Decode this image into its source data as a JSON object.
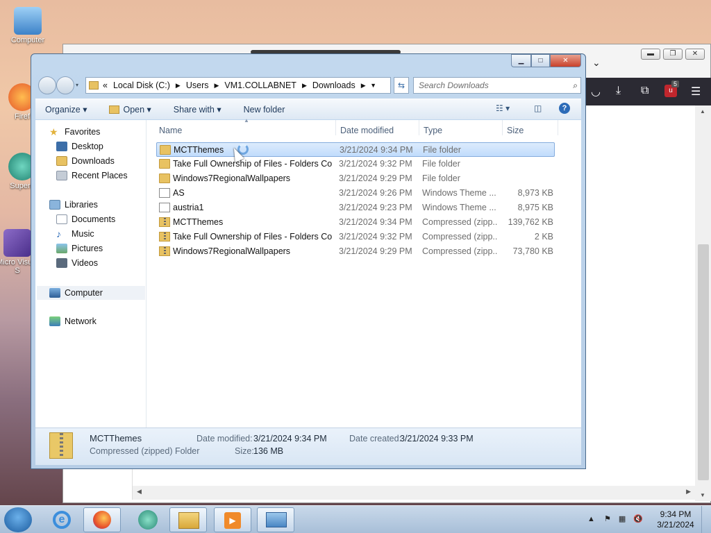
{
  "desktop": {
    "icons": [
      {
        "label": "Computer"
      },
      {
        "label": "Firef"
      },
      {
        "label": "Supern"
      },
      {
        "label": "Micro Visual S"
      }
    ]
  },
  "explorer": {
    "address": {
      "overflow": "«",
      "crumbs": [
        "Local Disk (C:)",
        "Users",
        "VM1.COLLABNET",
        "Downloads"
      ]
    },
    "search_placeholder": "Search Downloads",
    "commands": {
      "organize": "Organize ▾",
      "open": "Open ▾",
      "share": "Share with ▾",
      "new_folder": "New folder"
    },
    "nav": {
      "favorites": "Favorites",
      "desktop": "Desktop",
      "downloads": "Downloads",
      "recent": "Recent Places",
      "libraries": "Libraries",
      "documents": "Documents",
      "music": "Music",
      "pictures": "Pictures",
      "videos": "Videos",
      "computer": "Computer",
      "network": "Network"
    },
    "columns": {
      "name": "Name",
      "date": "Date modified",
      "type": "Type",
      "size": "Size"
    },
    "files": [
      {
        "name": "MCTThemes",
        "date": "3/21/2024 9:34 PM",
        "type": "File folder",
        "size": "",
        "icon": "folder"
      },
      {
        "name": "Take Full Ownership of Files - Folders Co...",
        "date": "3/21/2024 9:32 PM",
        "type": "File folder",
        "size": "",
        "icon": "folder"
      },
      {
        "name": "Windows7RegionalWallpapers",
        "date": "3/21/2024 9:29 PM",
        "type": "File folder",
        "size": "",
        "icon": "folder"
      },
      {
        "name": "AS",
        "date": "3/21/2024 9:26 PM",
        "type": "Windows Theme ...",
        "size": "8,973 KB",
        "icon": "theme"
      },
      {
        "name": "austria1",
        "date": "3/21/2024 9:23 PM",
        "type": "Windows Theme ...",
        "size": "8,975 KB",
        "icon": "theme"
      },
      {
        "name": "MCTThemes",
        "date": "3/21/2024 9:34 PM",
        "type": "Compressed (zipp...",
        "size": "139,762 KB",
        "icon": "zip"
      },
      {
        "name": "Take Full Ownership of Files - Folders Co...",
        "date": "3/21/2024 9:32 PM",
        "type": "Compressed (zipp...",
        "size": "2 KB",
        "icon": "zip"
      },
      {
        "name": "Windows7RegionalWallpapers",
        "date": "3/21/2024 9:29 PM",
        "type": "Compressed (zipp...",
        "size": "73,780 KB",
        "icon": "zip"
      }
    ],
    "details": {
      "name": "MCTThemes",
      "kind": "Compressed (zipped) Folder",
      "modified_label": "Date modified:",
      "modified_value": "3/21/2024 9:34 PM",
      "created_label": "Date created:",
      "created_value": "3/21/2024 9:33 PM",
      "size_label": "Size:",
      "size_value": "136 MB"
    }
  },
  "browser": {
    "badge": "5"
  },
  "taskbar": {
    "time": "9:34 PM",
    "date": "3/21/2024"
  }
}
